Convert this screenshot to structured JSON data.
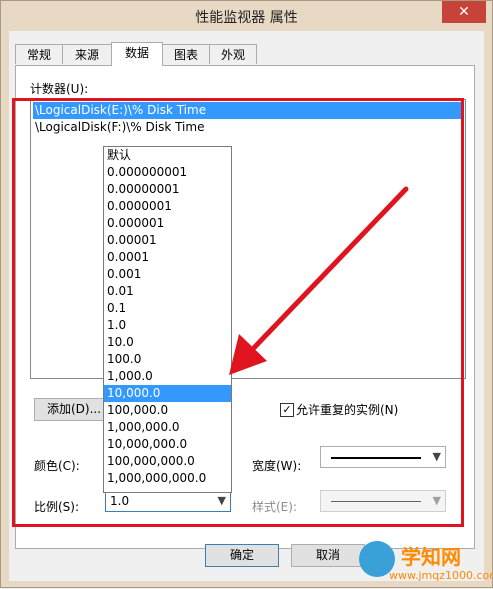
{
  "window": {
    "title": "性能监视器 属性",
    "close_label": "✕"
  },
  "tabs": [
    {
      "label": "常规"
    },
    {
      "label": "来源"
    },
    {
      "label": "数据"
    },
    {
      "label": "图表"
    },
    {
      "label": "外观"
    }
  ],
  "counters": {
    "label": "计数器(U):",
    "items": [
      "\\LogicalDisk(E:)\\% Disk Time",
      "\\LogicalDisk(F:)\\% Disk Time"
    ],
    "selected_index": 0
  },
  "buttons": {
    "add": "添加(D)...",
    "ok": "确定",
    "cancel": "取消"
  },
  "checkbox": {
    "label": "允许重复的实例(N)",
    "checked": true
  },
  "color_label": "颜色(C):",
  "scale_label": "比例(S):",
  "width_label": "宽度(W):",
  "style_label": "样式(E):",
  "scale_combo": {
    "value": "1.0"
  },
  "scale_options": [
    "默认",
    "0.000000001",
    "0.00000001",
    "0.0000001",
    "0.000001",
    "0.00001",
    "0.0001",
    "0.001",
    "0.01",
    "0.1",
    "1.0",
    "10.0",
    "100.0",
    "1,000.0",
    "10,000.0",
    "100,000.0",
    "1,000,000.0",
    "10,000,000.0",
    "100,000,000.0",
    "1,000,000,000.0"
  ],
  "scale_selected_index": 14,
  "watermark": {
    "title": "学知网",
    "url": "www.jmqz1000.com"
  },
  "colors": {
    "highlight": "#3399ff",
    "annotation": "#e0141e"
  }
}
